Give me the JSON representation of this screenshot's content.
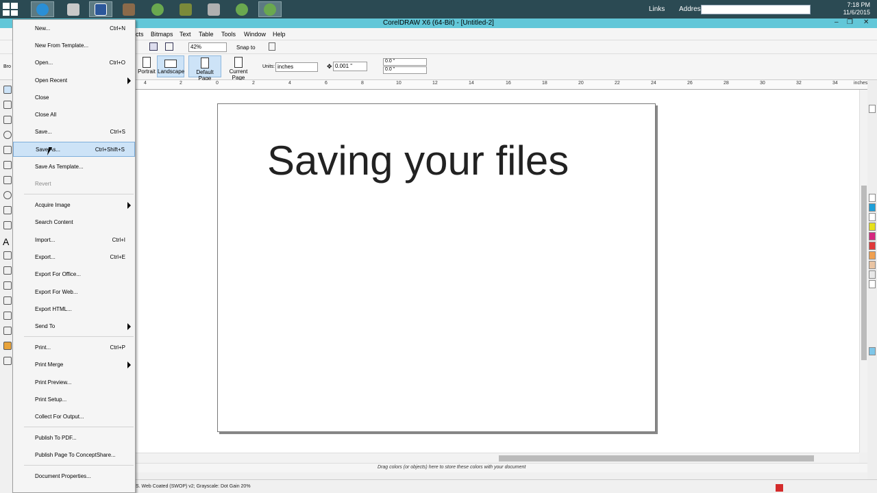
{
  "taskbar": {
    "links_label": "Links",
    "address_label": "Address",
    "clock_time": "7:18 PM",
    "clock_date": "11/6/2015"
  },
  "window": {
    "title": "CorelDRAW X6 (64-Bit) - [Untitled-2]"
  },
  "menubar": {
    "items": [
      "cts",
      "Bitmaps",
      "Text",
      "Table",
      "Tools",
      "Window",
      "Help"
    ]
  },
  "stdbar": {
    "zoom": "42%",
    "snap_label": "Snap to"
  },
  "propbar": {
    "font_partial": "Bro",
    "portrait": "Portrait",
    "landscape": "Landscape",
    "default_page": "Default Page",
    "current_page": "Current Page",
    "units_label": "Units:",
    "units_value": "inches",
    "nudge": "0.001 \"",
    "dup_x": "0.0 \"",
    "dup_y": "0.0 \""
  },
  "ruler": {
    "labels": [
      "4",
      "2",
      "0",
      "2",
      "4",
      "6",
      "8",
      "10",
      "12",
      "14",
      "16",
      "18",
      "20",
      "22",
      "24",
      "26",
      "28",
      "30",
      "32",
      "34"
    ],
    "unit": "inches"
  },
  "page": {
    "text": "Saving your files"
  },
  "file_menu": {
    "items": [
      {
        "label": "New...",
        "shortcut": "Ctrl+N"
      },
      {
        "label": "New From Template...",
        "shortcut": ""
      },
      {
        "label": "Open...",
        "shortcut": "Ctrl+O"
      },
      {
        "label": "Open Recent",
        "shortcut": ""
      },
      {
        "label": "Close",
        "shortcut": ""
      },
      {
        "label": "Close All",
        "shortcut": ""
      },
      {
        "label": "Save...",
        "shortcut": "Ctrl+S"
      },
      {
        "label": "Save As...",
        "shortcut": "Ctrl+Shift+S"
      },
      {
        "label": "Save As Template...",
        "shortcut": ""
      },
      {
        "label": "Revert",
        "shortcut": ""
      },
      {
        "label": "Acquire Image",
        "shortcut": ""
      },
      {
        "label": "Search Content",
        "shortcut": ""
      },
      {
        "label": "Import...",
        "shortcut": "Ctrl+I"
      },
      {
        "label": "Export...",
        "shortcut": "Ctrl+E"
      },
      {
        "label": "Export For Office...",
        "shortcut": ""
      },
      {
        "label": "Export For Web...",
        "shortcut": ""
      },
      {
        "label": "Export HTML...",
        "shortcut": ""
      },
      {
        "label": "Send To",
        "shortcut": ""
      },
      {
        "label": "Print...",
        "shortcut": "Ctrl+P"
      },
      {
        "label": "Print Merge",
        "shortcut": ""
      },
      {
        "label": "Print Preview...",
        "shortcut": ""
      },
      {
        "label": "Print Setup...",
        "shortcut": ""
      },
      {
        "label": "Collect For Output...",
        "shortcut": ""
      },
      {
        "label": "Publish To PDF...",
        "shortcut": ""
      },
      {
        "label": "Publish Page To ConceptShare...",
        "shortcut": ""
      },
      {
        "label": "Document Properties...",
        "shortcut": ""
      }
    ]
  },
  "bottom": {
    "drag_hint": "Drag colors (or objects) here to store these colors with your document",
    "status": "S. Web Coated (SWOP) v2; Grayscale: Dot Gain 20%"
  },
  "colors": {
    "taskbar": "#2b4a53",
    "titlebar": "#62c7d8",
    "highlight": "#cde3f7",
    "fill_swatch": "#d42b2b"
  }
}
